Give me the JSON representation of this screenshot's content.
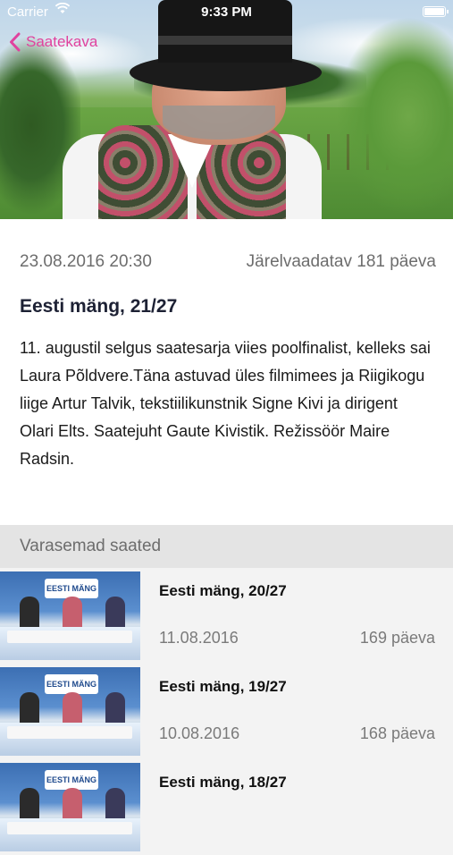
{
  "status_bar": {
    "carrier": "Carrier",
    "time": "9:33 PM"
  },
  "nav": {
    "back_label": "Saatekava"
  },
  "program": {
    "datetime": "23.08.2016 20:30",
    "availability": "Järelvaadatav 181 päeva",
    "title": "Eesti mäng, 21/27",
    "description": "11. augustil selgus saatesarja viies poolfinalist, kelleks sai Laura Põldvere.Täna astuvad üles filmimees ja Riigikogu liige Artur Talvik, tekstiilikunstnik Signe Kivi ja dirigent Olari Elts. Saatejuht Gaute Kivistik. Režissöör Maire Radsin."
  },
  "previous": {
    "header": "Varasemad saated",
    "items": [
      {
        "title": "Eesti mäng, 20/27",
        "date": "11.08.2016",
        "days": "169 päeva",
        "thumb_logo": "EESTI MÄNG"
      },
      {
        "title": "Eesti mäng, 19/27",
        "date": "10.08.2016",
        "days": "168 päeva",
        "thumb_logo": "EESTI MÄNG"
      },
      {
        "title": "Eesti mäng, 18/27",
        "date": "",
        "days": "",
        "thumb_logo": "EESTI MÄNG"
      }
    ]
  },
  "colors": {
    "accent": "#e0429e",
    "section_bg": "#e4e4e4",
    "row_bg": "#f3f3f3"
  }
}
